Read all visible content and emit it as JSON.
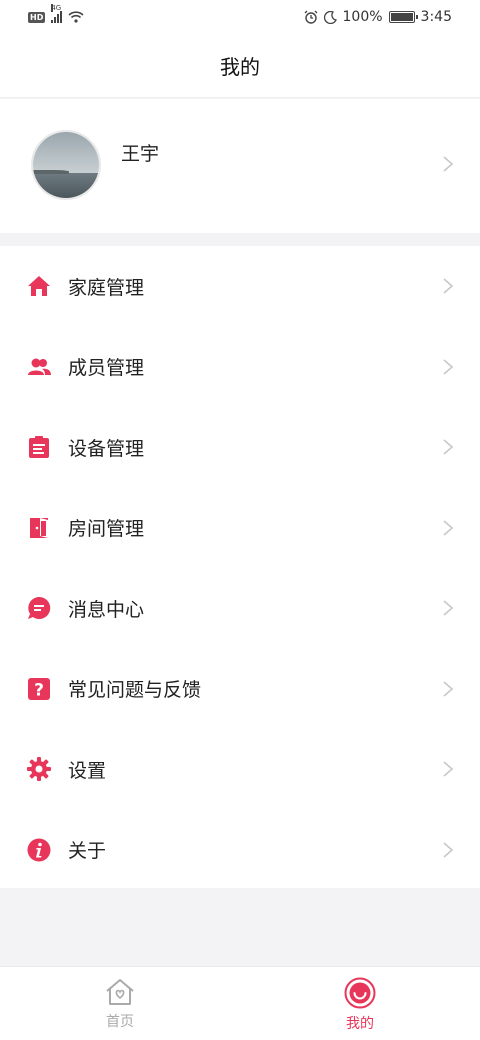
{
  "status_bar": {
    "network_badge": "HD",
    "network_type": "4G",
    "battery": "100%",
    "time": "3:45",
    "icons": [
      "signal-icon",
      "wifi-icon",
      "alarm-icon",
      "moon-icon",
      "battery-icon"
    ]
  },
  "header": {
    "title": "我的"
  },
  "profile": {
    "name": "王宇"
  },
  "menu": {
    "items": [
      {
        "label": "家庭管理",
        "icon": "home-icon"
      },
      {
        "label": "成员管理",
        "icon": "members-icon"
      },
      {
        "label": "设备管理",
        "icon": "device-list-icon"
      },
      {
        "label": "房间管理",
        "icon": "door-icon"
      },
      {
        "label": "消息中心",
        "icon": "message-icon"
      },
      {
        "label": "常见问题与反馈",
        "icon": "question-icon"
      },
      {
        "label": "设置",
        "icon": "gear-icon"
      },
      {
        "label": "关于",
        "icon": "info-icon"
      }
    ]
  },
  "tabbar": {
    "tabs": [
      {
        "label": "首页",
        "icon": "home-outline-icon",
        "active": false
      },
      {
        "label": "我的",
        "icon": "smile-icon",
        "active": true
      }
    ]
  },
  "colors": {
    "accent": "#e8365a",
    "inactive": "#aaaaaa"
  }
}
